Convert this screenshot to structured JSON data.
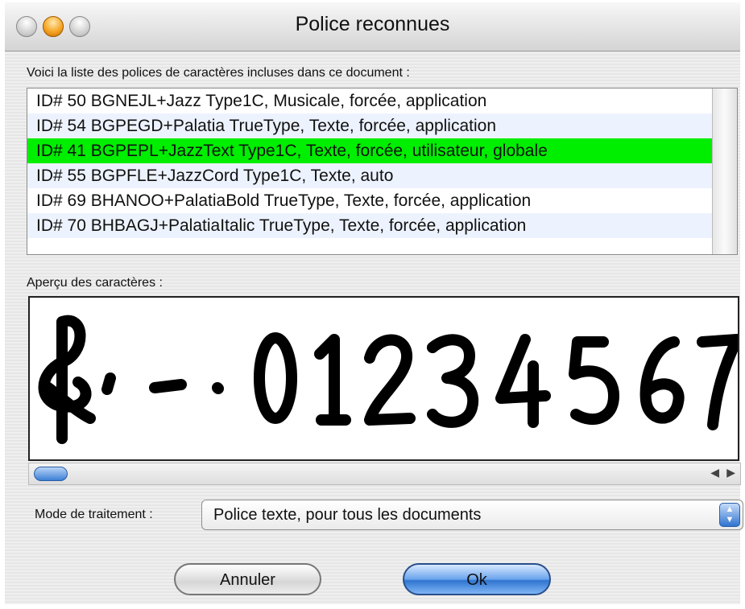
{
  "window": {
    "title": "Police reconnues"
  },
  "list": {
    "label": "Voici la liste des polices de caractères incluses dans ce document :",
    "items": [
      "ID# 50 BGNEJL+Jazz Type1C, Musicale, forcée, application",
      "ID# 54 BGPEGD+Palatia TrueType, Texte, forcée, application",
      "ID# 41 BGPEPL+JazzText Type1C, Texte, forcée, utilisateur, globale",
      "ID# 55 BGPFLE+JazzCord Type1C, Texte, auto",
      "ID# 69 BHANOO+PalatiaBold TrueType, Texte, forcée, application",
      "ID# 70 BHBAGJ+PalatiaItalic TrueType, Texte, forcée, application"
    ],
    "selected_index": 2,
    "selected_color": "#00ee00"
  },
  "preview": {
    "label": "Aperçu des caractères :",
    "glyphs": "&,-.01234567"
  },
  "mode": {
    "label": "Mode de traitement :",
    "value": "Police texte, pour tous les documents"
  },
  "buttons": {
    "cancel": "Annuler",
    "ok": "Ok"
  }
}
